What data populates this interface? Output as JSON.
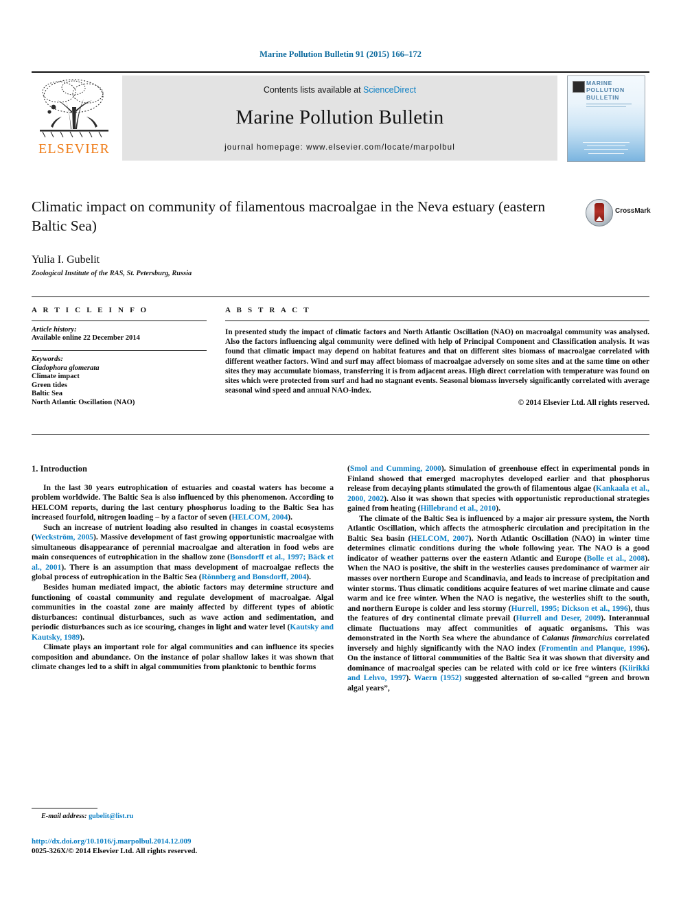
{
  "running_head": "Marine Pollution Bulletin 91 (2015) 166–172",
  "masthead": {
    "contents_line_prefix": "Contents lists available at ",
    "sciencedirect": "ScienceDirect",
    "journal_title": "Marine Pollution Bulletin",
    "homepage_line": "journal homepage: www.elsevier.com/locate/marpolbul",
    "publisher_wordmark": "ELSEVIER",
    "cover_title": "MARINE POLLUTION BULLETIN",
    "brand_orange": "#ef7d1a",
    "link_blue": "#0b7fc4",
    "banner_gray": "#e3e3e3"
  },
  "article": {
    "title": "Climatic impact on community of filamentous macroalgae in the Neva estuary (eastern Baltic Sea)",
    "author": "Yulia I. Gubelit",
    "affiliation": "Zoological Institute of the RAS, St. Petersburg, Russia",
    "crossmark_label": "CrossMark"
  },
  "article_info": {
    "heading": "A R T I C L E   I N F O",
    "history_label": "Article history:",
    "history_lines": [
      "Available online 22 December 2014"
    ],
    "keywords_label": "Keywords:",
    "keywords": [
      "Cladophora glomerata",
      "Climate impact",
      "Green tides",
      "Baltic Sea",
      "North Atlantic Oscillation (NAO)"
    ]
  },
  "abstract": {
    "heading": "A B S T R A C T",
    "text": "In presented study the impact of climatic factors and North Atlantic Oscillation (NAO) on macroalgal community was analysed. Also the factors influencing algal community were defined with help of Principal Component and Classification analysis. It was found that climatic impact may depend on habitat features and that on different sites biomass of macroalgae correlated with different weather factors. Wind and surf may affect biomass of macroalgae adversely on some sites and at the same time on other sites they may accumulate biomass, transferring it is from adjacent areas. High direct correlation with temperature was found on sites which were protected from surf and had no stagnant events. Seasonal biomass inversely significantly correlated with average seasonal wind speed and annual NAO-index.",
    "copyright": "© 2014 Elsevier Ltd. All rights reserved."
  },
  "sections": {
    "intro_heading": "1. Introduction"
  },
  "footnote": {
    "label": "E-mail address:",
    "email": "gubelit@list.ru"
  },
  "footer": {
    "doi": "http://dx.doi.org/10.1016/j.marpolbul.2014.12.009",
    "issn_line": "0025-326X/© 2014 Elsevier Ltd. All rights reserved."
  }
}
